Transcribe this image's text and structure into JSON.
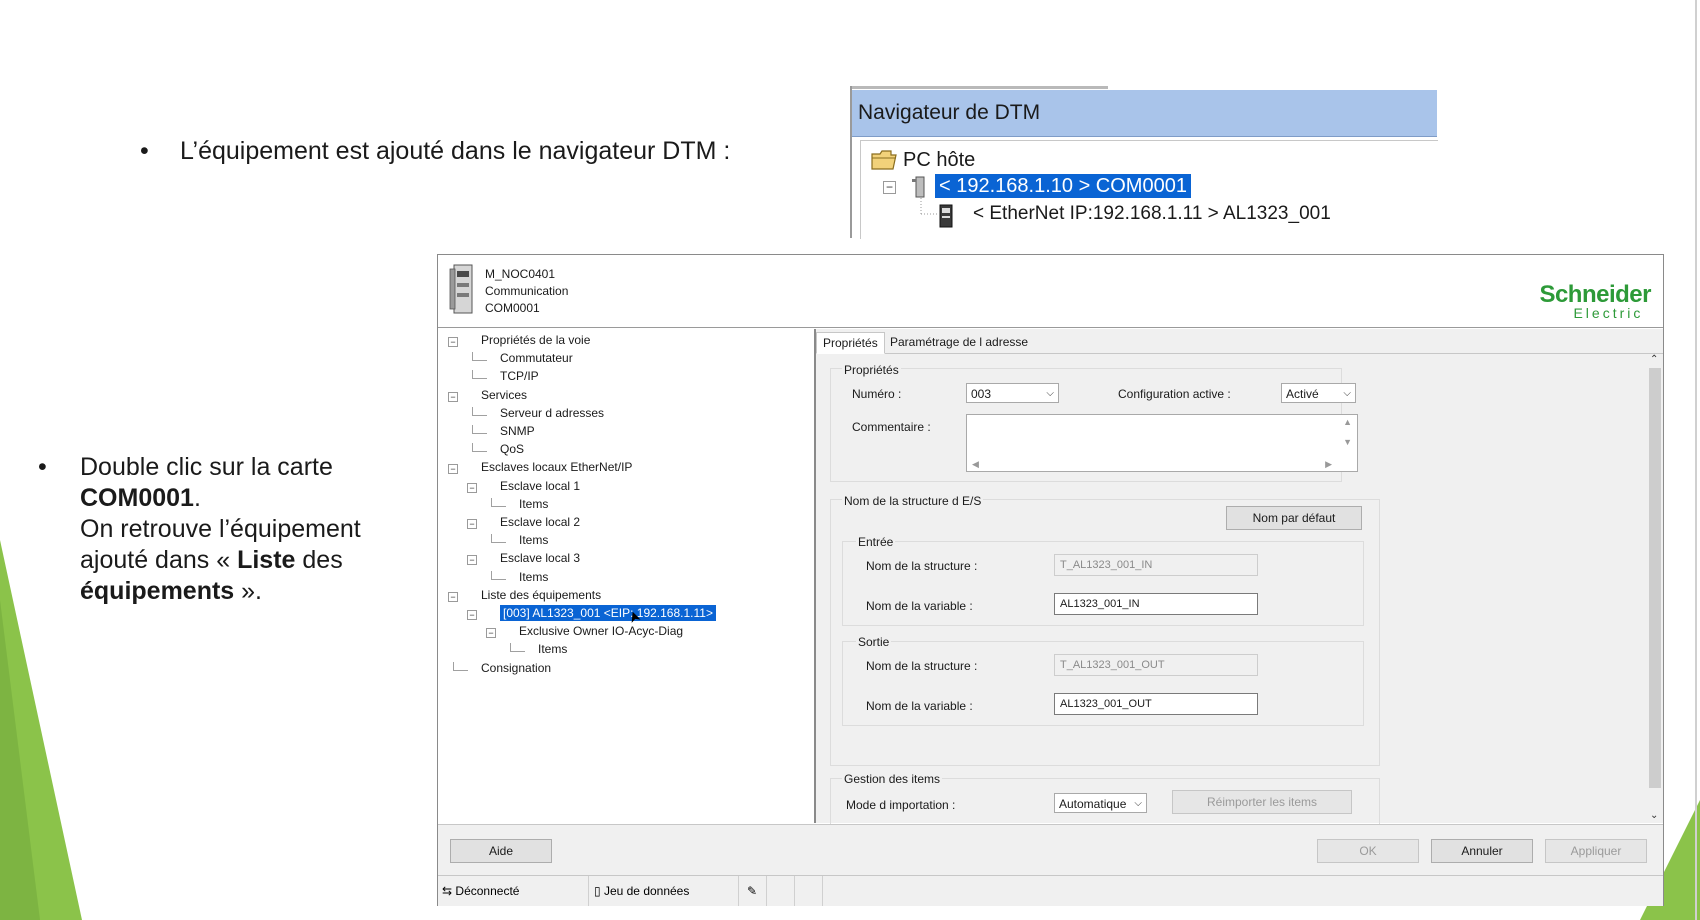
{
  "slide": {
    "bullet1": {
      "marker": "•",
      "text": "L’équipement est ajouté dans le navigateur DTM :"
    },
    "bullet2": {
      "marker": "•",
      "line1": "Double clic sur la carte",
      "line2_bold": "COM0001",
      "line2_rest": ".",
      "line3": "On retrouve l’équipement",
      "line4_pre": "ajouté dans « ",
      "line4_bold": "Liste",
      "line4_post": " des",
      "line5_bold": "équipements",
      "line5_post": " »."
    },
    "colors": {
      "accent_green": "#8bc34a"
    }
  },
  "navigator": {
    "title": "Navigateur de DTM",
    "root": "PC hôte",
    "selected": "< 192.168.1.10 > COM0001",
    "child": "< EtherNet IP:192.168.1.11 > AL1323_001",
    "icons": [
      "folder-icon",
      "network-card-icon",
      "device-icon"
    ]
  },
  "dialog": {
    "header": {
      "line1": "M_NOC0401",
      "line2": "Communication",
      "line3": "COM0001",
      "brand_top": "Schneider",
      "brand_bottom": "Electric"
    },
    "tree": [
      {
        "label": "Propriétés de la voie",
        "level": 0,
        "box": "−"
      },
      {
        "label": "Commutateur",
        "level": 1
      },
      {
        "label": "TCP/IP",
        "level": 1
      },
      {
        "label": "Services",
        "level": 0,
        "box": "−"
      },
      {
        "label": "Serveur d adresses",
        "level": 1
      },
      {
        "label": "SNMP",
        "level": 1
      },
      {
        "label": "QoS",
        "level": 1
      },
      {
        "label": "Esclaves locaux EtherNet/IP",
        "level": 0,
        "box": "−"
      },
      {
        "label": "Esclave local 1",
        "level": 1,
        "box": "−"
      },
      {
        "label": "Items",
        "level": 2
      },
      {
        "label": "Esclave local 2",
        "level": 1,
        "box": "−"
      },
      {
        "label": "Items",
        "level": 2
      },
      {
        "label": "Esclave local 3",
        "level": 1,
        "box": "−"
      },
      {
        "label": "Items",
        "level": 2
      },
      {
        "label": "Liste des équipements",
        "level": 0,
        "box": "−"
      },
      {
        "label": "[003] AL1323_001 <EIP: 192.168.1.11>",
        "level": 1,
        "box": "−",
        "selected": true
      },
      {
        "label": "Exclusive Owner IO-Acyc-Diag",
        "level": 2,
        "box": "−"
      },
      {
        "label": "Items",
        "level": 3
      },
      {
        "label": "Consignation",
        "level": 0
      }
    ],
    "tabs": [
      "Propriétés",
      "Paramétrage de l adresse"
    ],
    "active_tab": "Propriétés",
    "props": {
      "group_title": "Propriétés",
      "numero_label": "Numéro :",
      "numero_value": "003",
      "config_label": "Configuration active :",
      "config_value": "Activé",
      "comment_label": "Commentaire :",
      "comment_value": ""
    },
    "io": {
      "group_title": "Nom de la structure d E/S",
      "default_button": "Nom par défaut",
      "entree_title": "Entrée",
      "entree_struct_label": "Nom de la structure :",
      "entree_struct_value": "T_AL1323_001_IN",
      "entree_var_label": "Nom de la variable :",
      "entree_var_value": "AL1323_001_IN",
      "sortie_title": "Sortie",
      "sortie_struct_label": "Nom de la structure :",
      "sortie_struct_value": "T_AL1323_001_OUT",
      "sortie_var_label": "Nom de la variable :",
      "sortie_var_value": "AL1323_001_OUT"
    },
    "items": {
      "group_title": "Gestion des items",
      "mode_label": "Mode d importation :",
      "mode_value": "Automatique",
      "reimport_button": "Réimporter les items"
    },
    "buttons": {
      "help": "Aide",
      "ok": "OK",
      "cancel": "Annuler",
      "apply": "Appliquer"
    },
    "status": {
      "connection": "Déconnecté",
      "dataset": "Jeu de données"
    }
  }
}
